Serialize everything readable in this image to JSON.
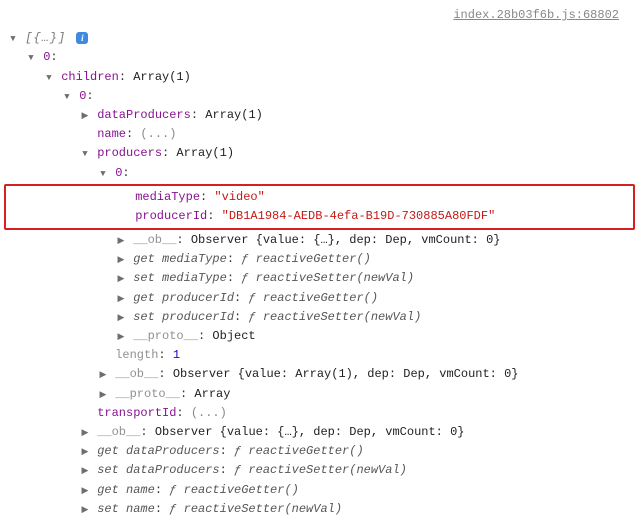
{
  "source": {
    "file": "index.28b03f6b.js",
    "line": "68802"
  },
  "root_label": "[{…}]",
  "idx0": "0",
  "children_key": "children",
  "children_type": "Array(1)",
  "child0_idx": "0",
  "dataProducers_key": "dataProducers",
  "dataProducers_type": "Array(1)",
  "name_key": "name",
  "name_val": "(...)",
  "producers_key": "producers",
  "producers_type": "Array(1)",
  "prod0_idx": "0",
  "prod0": {
    "mediaType_key": "mediaType",
    "mediaType_val": "\"video\"",
    "producerId_key": "producerId",
    "producerId_val": "\"DB1A1984-AEDB-4efa-B19D-730885A80FDF\"",
    "ob_key": "__ob__",
    "ob_val": "Observer {value: {…}, dep: Dep, vmCount: 0}",
    "get_mediaType_key": "get mediaType",
    "get_mediaType_val": "ƒ reactiveGetter()",
    "set_mediaType_key": "set mediaType",
    "set_mediaType_val": "ƒ reactiveSetter(newVal)",
    "get_producerId_key": "get producerId",
    "get_producerId_val": "ƒ reactiveGetter()",
    "set_producerId_key": "set producerId",
    "set_producerId_val": "ƒ reactiveSetter(newVal)",
    "proto_key": "__proto__",
    "proto_val": "Object"
  },
  "producers_length_key": "length",
  "producers_length_val": "1",
  "producers_ob_key": "__ob__",
  "producers_ob_val": "Observer {value: Array(1), dep: Dep, vmCount: 0}",
  "producers_proto_key": "__proto__",
  "producers_proto_val": "Array",
  "transportId_key": "transportId",
  "transportId_val": "(...)",
  "child0_ob_key": "__ob__",
  "child0_ob_val": "Observer {value: {…}, dep: Dep, vmCount: 0}",
  "child0_get_dp_key": "get dataProducers",
  "child0_get_dp_val": "ƒ reactiveGetter()",
  "child0_set_dp_key": "set dataProducers",
  "child0_set_dp_val": "ƒ reactiveSetter(newVal)",
  "child0_get_name_key": "get name",
  "child0_get_name_val": "ƒ reactiveGetter()",
  "child0_set_name_key": "set name",
  "child0_set_name_val": "ƒ reactiveSetter(newVal)"
}
